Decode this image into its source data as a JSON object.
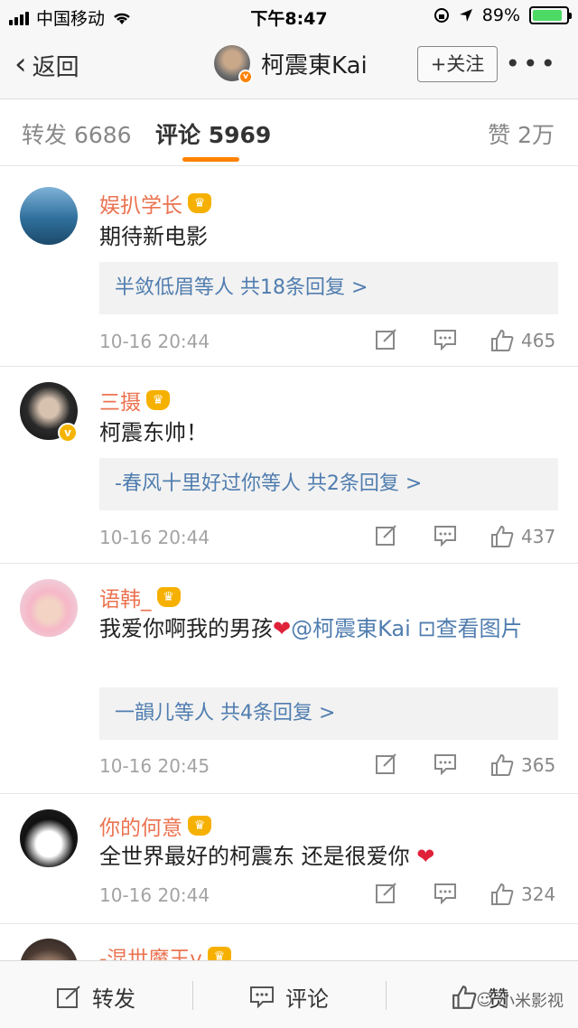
{
  "status_bar": {
    "carrier": "中国移动",
    "time": "下午8:47",
    "battery": "89%"
  },
  "nav": {
    "back_label": "返回",
    "user_name": "柯震東Kai",
    "follow_label": "+关注",
    "more_label": "•••"
  },
  "tabs": {
    "repost": "转发 6686",
    "comments": "评论 5969",
    "likes": "赞 2万"
  },
  "comments": [
    {
      "username": "娱扒学长",
      "text": "期待新电影",
      "reply_summary": "半敛低眉等人  共18条回复 >",
      "time": "10-16 20:44",
      "likes": "465"
    },
    {
      "username": "三摄",
      "text": "柯震东帅！",
      "reply_summary": "-春风十里好过你等人  共2条回复 >",
      "time": "10-16 20:44",
      "likes": "437"
    },
    {
      "username": "语韩_",
      "text_before": "我爱你啊我的男孩",
      "mention": "@柯震東Kai",
      "pic_link": "⊡查看图片",
      "reply_summary": "一韻儿等人  共4条回复 >",
      "time": "10-16 20:45",
      "likes": "365"
    },
    {
      "username": "你的何意",
      "text": "全世界最好的柯震东 还是很爱你",
      "time": "10-16 20:44",
      "likes": "324"
    },
    {
      "username": "-混世魔王v"
    }
  ],
  "bottom_bar": {
    "repost": "转发",
    "comment": "评论",
    "like": "赞",
    "watermark": "小米影视"
  },
  "colors": {
    "accent": "#ff8200",
    "username": "#eb7350",
    "link": "#507daf",
    "heart": "#e0213a"
  }
}
